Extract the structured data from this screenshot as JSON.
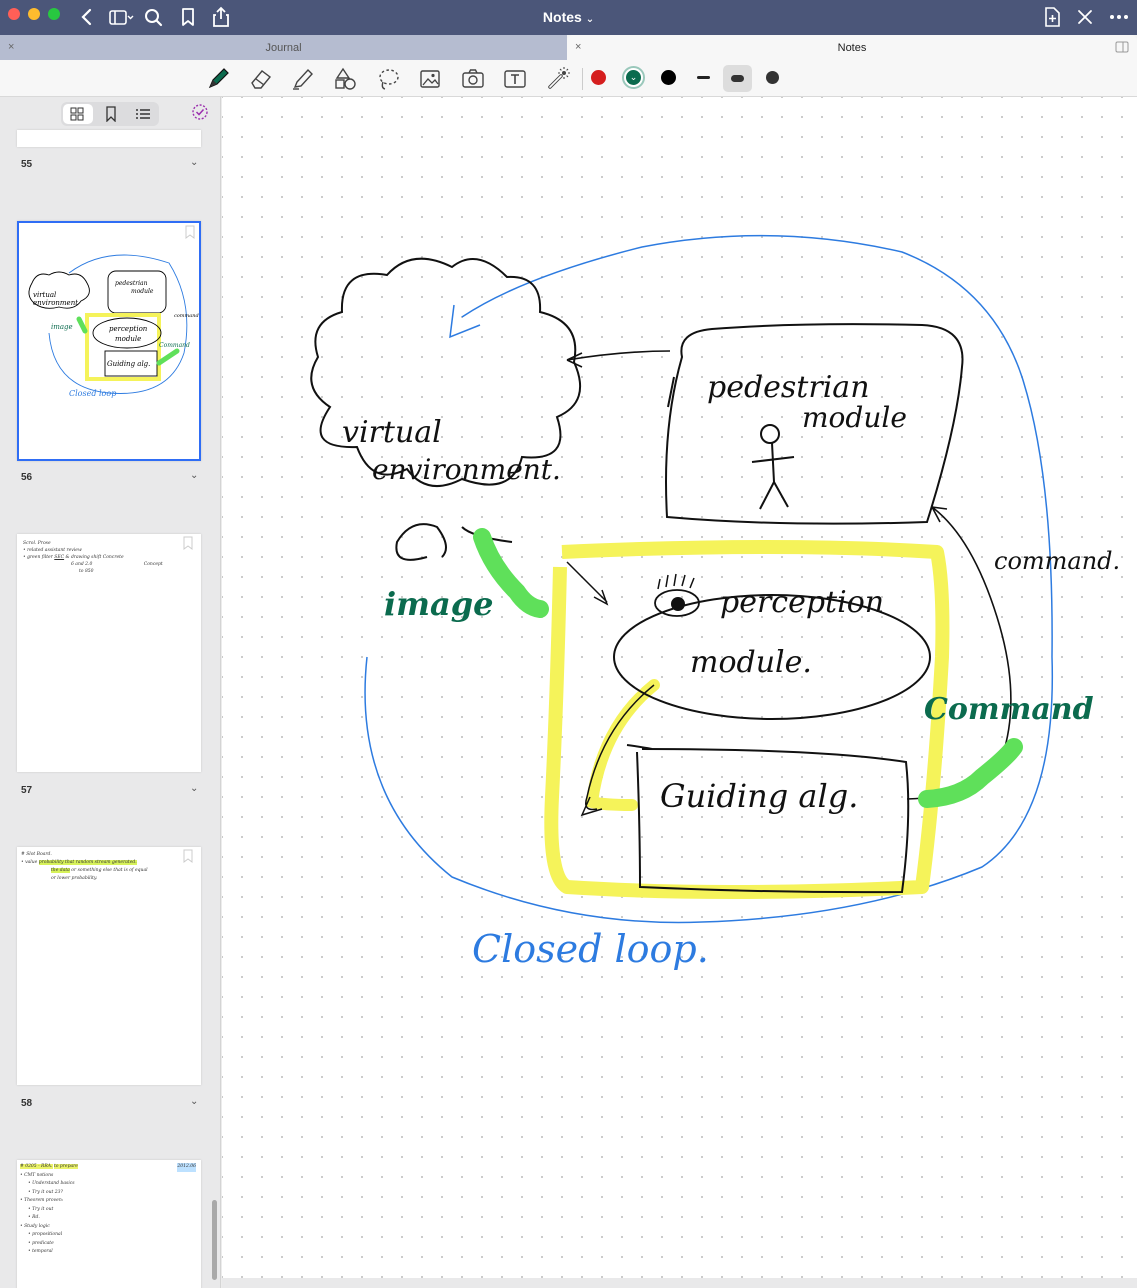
{
  "app": {
    "title": "Notes",
    "title_chevron": "⌄"
  },
  "tabs": [
    {
      "label": "Journal",
      "close": "×"
    },
    {
      "label": "Notes",
      "close": "×"
    }
  ],
  "colors": {
    "titlebar": "#4b5679",
    "pen_red": "#d51e1e",
    "pen_green": "#0b6b4e",
    "pen_black": "#000000",
    "ink_blue": "#2d7be0",
    "highlight_yellow": "#f5f35a",
    "highlight_green": "#5fe05a",
    "selection_blue": "#2f6df5"
  },
  "toolbar": {
    "tools": [
      "pen-icon",
      "eraser-icon",
      "highlighter-icon",
      "shapes-icon",
      "lasso-icon",
      "image-icon",
      "camera-icon",
      "text-box-icon",
      "laser-pointer-icon"
    ],
    "swatches": [
      "red",
      "green",
      "black"
    ]
  },
  "sidebar": {
    "pages": [
      {
        "number": "55"
      },
      {
        "number": "56"
      },
      {
        "number": "57"
      },
      {
        "number": "58"
      }
    ],
    "page57_lines": [
      "Scrol. Prose",
      "• related assistant review",
      "• green filter",
      "SEC",
      "& drawing shift",
      "Concrete",
      "6 and 2.0",
      "Concept",
      "to 850"
    ],
    "page58_lines": [
      "# Slot Board.",
      "• value",
      "probability that random stream generated.",
      "the data",
      "or something else that is of equal",
      "or lower probability."
    ],
    "page59_lines": [
      "# 0205 - RRA.",
      "to prepare",
      "2012.06",
      "• CMT notions",
      "• Understand basics",
      "• Try it out 23?",
      "• Theorem proven:",
      "• Try it out",
      "• Rd.",
      "• Study logic",
      "• propositional",
      "• predicate",
      "• temporal"
    ],
    "thumb56_labels": [
      "virtual",
      "environment",
      "pedestrian",
      "module",
      "perception",
      "module",
      "image",
      "Guiding alg.",
      "command",
      "Command",
      "Closed loop"
    ]
  },
  "diagram": {
    "virtual_env": [
      "virtual",
      "environment."
    ],
    "pedestrian": [
      "pedestrian",
      "module"
    ],
    "perception": [
      "perception",
      "module."
    ],
    "guiding": "Guiding alg.",
    "image_label": "image",
    "command_black": "command.",
    "command_green": "Command",
    "closed_loop": "Closed loop."
  }
}
